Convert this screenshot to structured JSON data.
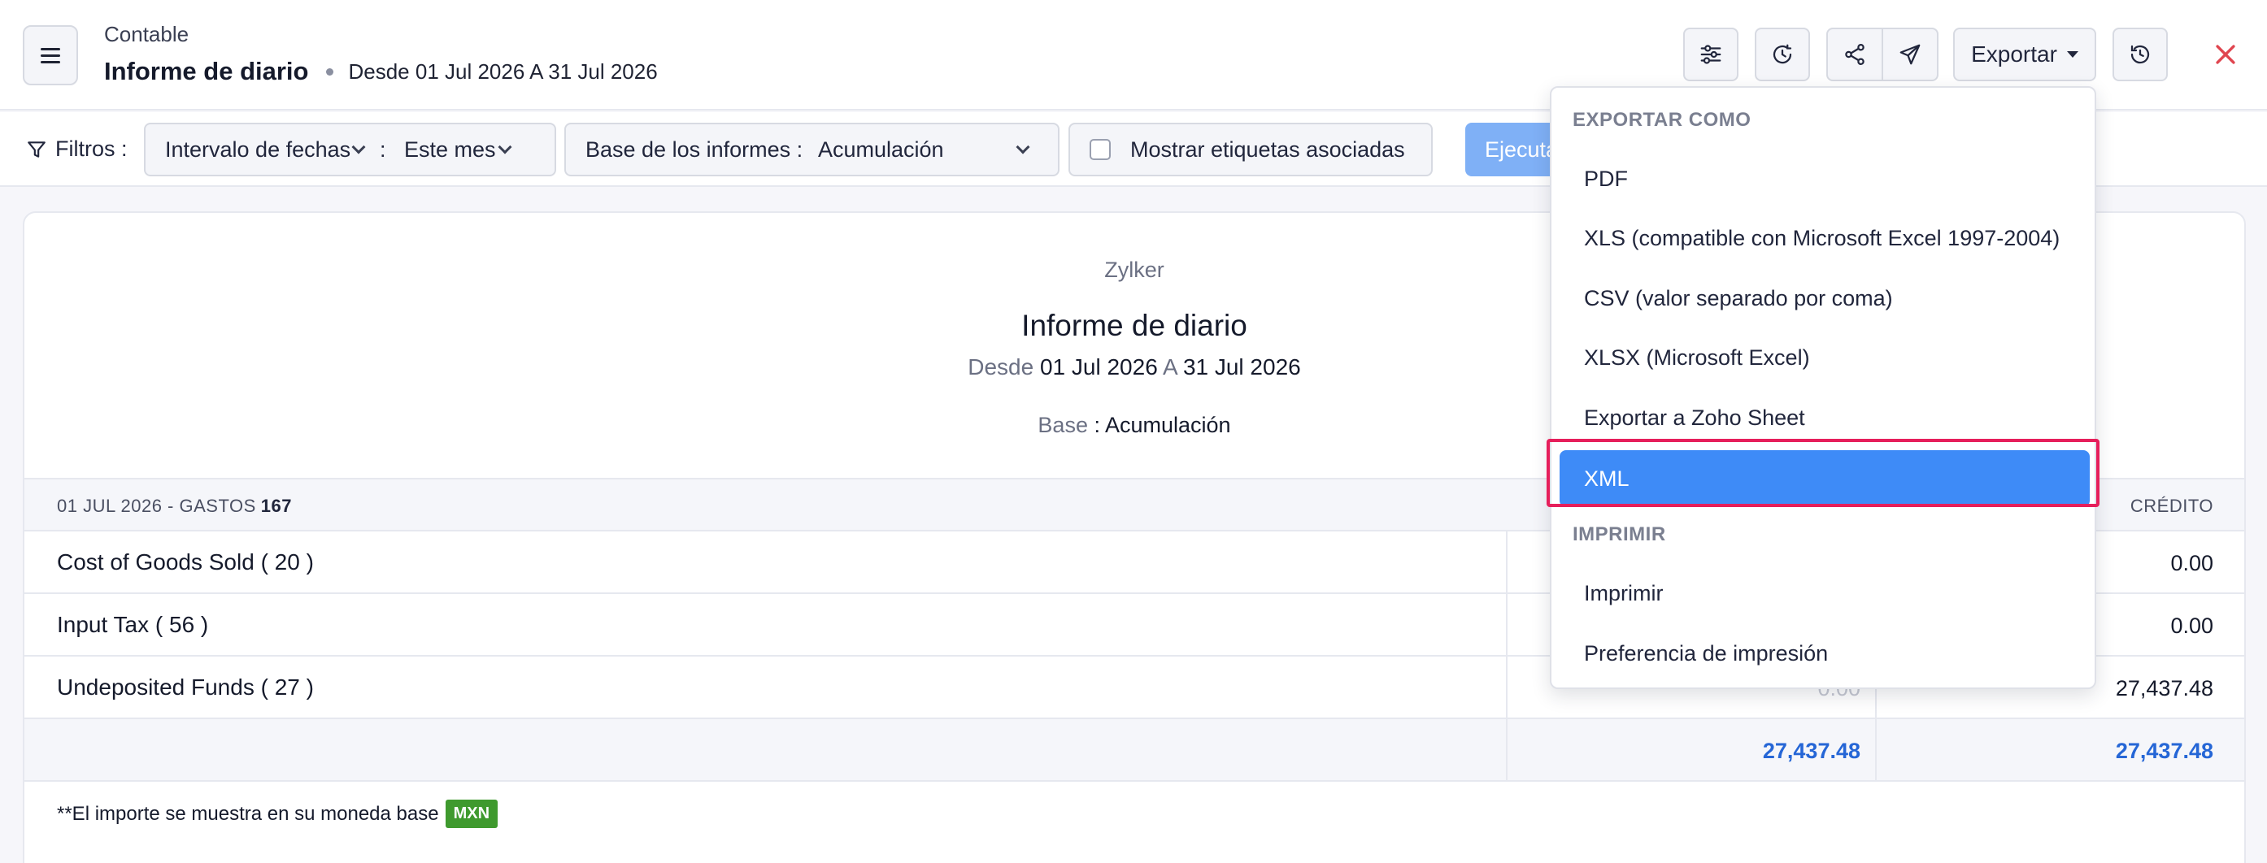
{
  "header": {
    "breadcrumb": "Contable",
    "title": "Informe de diario",
    "range": "Desde 01 Jul 2026 A 31 Jul 2026",
    "export_label": "Exportar"
  },
  "filters": {
    "label": "Filtros :",
    "date_interval_label": "Intervalo de fechas",
    "date_interval_value": "Este mes",
    "basis_label": "Base de los informes :",
    "basis_value": "Acumulación",
    "show_tags_label": "Mostrar etiquetas asociadas",
    "run_label": "Ejecutar informe"
  },
  "report": {
    "org": "Zylker",
    "title": "Informe de diario",
    "range_from_label": "Desde",
    "range_from": "01 Jul 2026",
    "range_to_label": "A",
    "range_to": "31 Jul 2026",
    "basis_label": "Base",
    "basis_value": ": Acumulación",
    "group_header": "01 JUL 2026 -  GASTOS",
    "group_number": "167",
    "credit_header": "CRÉDITO",
    "rows": [
      {
        "account": "Cost of Goods Sold ( 20 )",
        "credit": "0.00"
      },
      {
        "account": "Input Tax ( 56 )",
        "credit": "0.00"
      },
      {
        "account": "Undeposited Funds ( 27 )",
        "debit": "0.00",
        "credit": "27,437.48"
      }
    ],
    "total_debit": "27,437.48",
    "total_credit": "27,437.48",
    "footnote": "**El importe se muestra en su moneda base",
    "currency": "MXN"
  },
  "export_menu": {
    "section_export": "EXPORTAR COMO",
    "items": [
      "PDF",
      "XLS (compatible con Microsoft Excel 1997-2004)",
      "CSV (valor separado por coma)",
      "XLSX (Microsoft Excel)",
      "Exportar a Zoho Sheet"
    ],
    "selected": "XML",
    "section_print": "IMPRIMIR",
    "print_items": [
      "Imprimir",
      "Preferencia de impresión"
    ]
  },
  "colors": {
    "accent": "#3e8bf7",
    "highlight": "#e61f5b",
    "total_text": "#2566d6",
    "badge": "#3f9a2e"
  }
}
